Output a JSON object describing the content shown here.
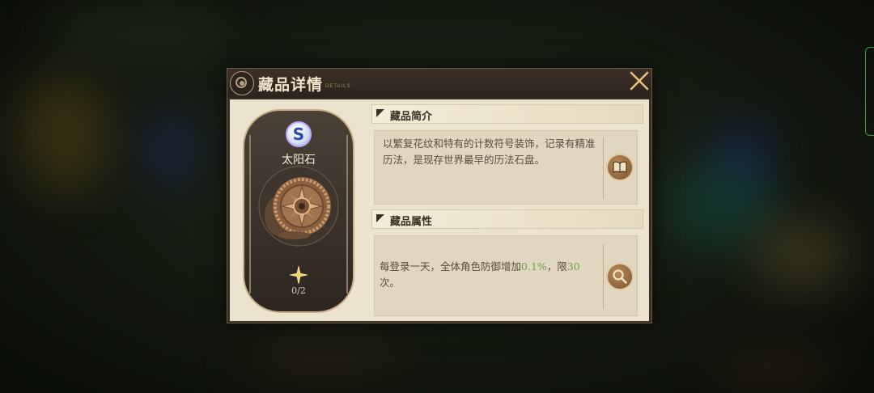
{
  "dialog": {
    "title": "藏品详情",
    "subtitle": "DETAILS"
  },
  "item": {
    "rarity": "S",
    "name": "太阳石",
    "progress": "0/2"
  },
  "intro": {
    "title": "藏品简介",
    "text": "以繁复花纹和特有的计数符号装饰，记录有精准历法，是现存世界最早的历法石盘。"
  },
  "attributes": {
    "title": "藏品属性",
    "text_before": "每登录一天，全体角色防御增加",
    "value": "0.1%",
    "text_middle": "，限",
    "limit": "30",
    "text_after": "次。"
  },
  "colors": {
    "highlight": "#6aa640",
    "panel": "#ece3ce",
    "frame": "#3a2f25"
  },
  "icons": {
    "header": "emblem-icon",
    "close": "close-icon",
    "intro_button": "book-icon",
    "attributes_button": "magnifier-icon",
    "progress": "star-icon"
  }
}
